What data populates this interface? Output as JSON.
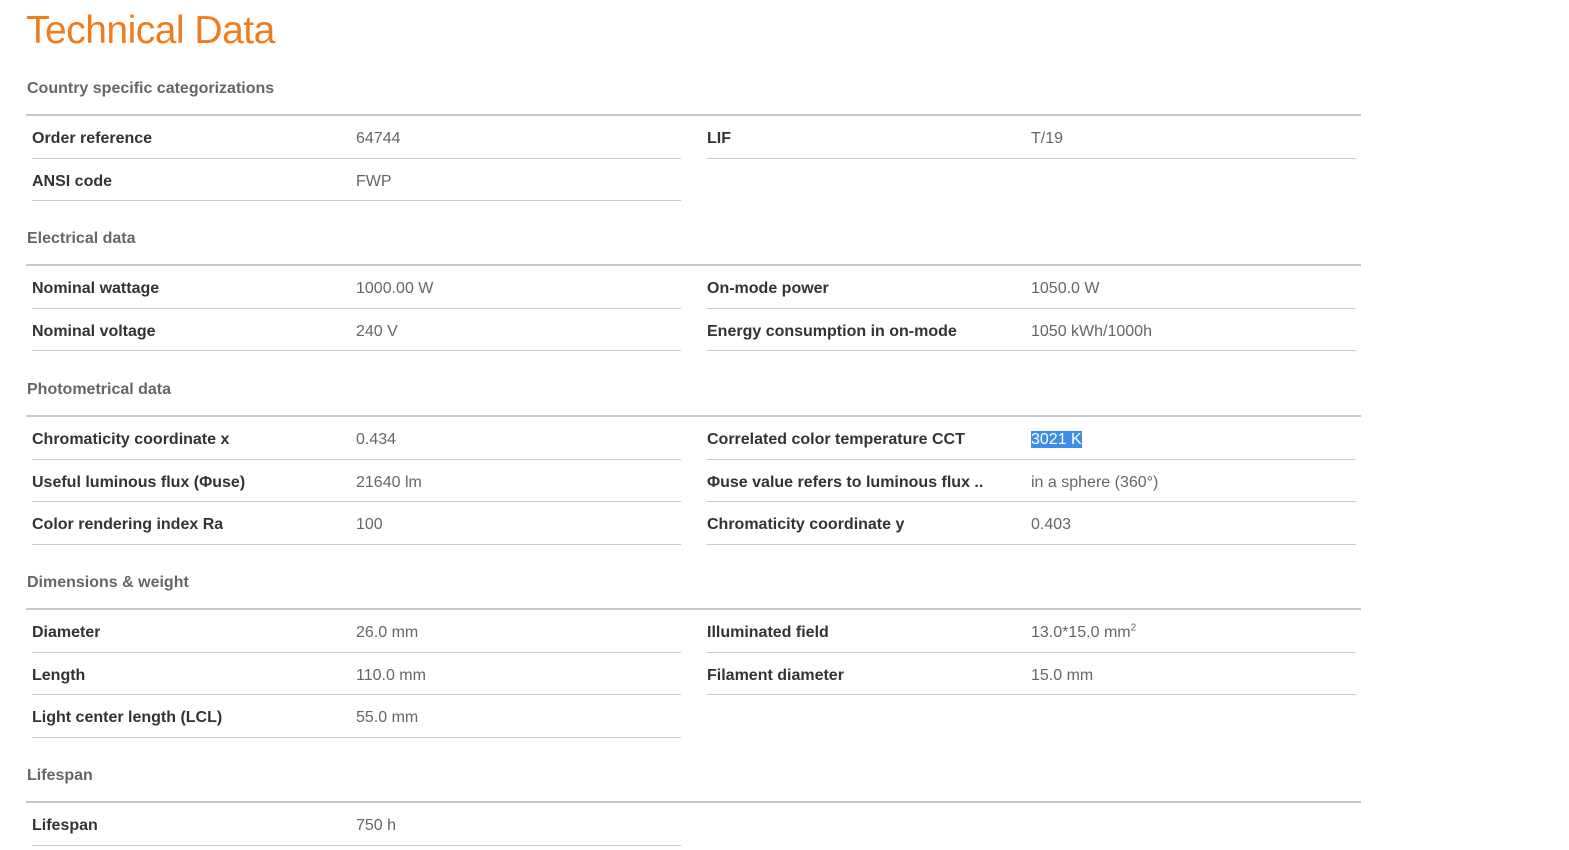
{
  "page": {
    "title": "Technical Data",
    "accent_color": "#ef7d1f"
  },
  "sections": [
    {
      "title": "Country specific categorizations",
      "left": [
        {
          "label": "Order reference",
          "value": "64744"
        },
        {
          "label": "ANSI code",
          "value": "FWP"
        }
      ],
      "right": [
        {
          "label": "LIF",
          "value": "T/19"
        }
      ]
    },
    {
      "title": "Electrical data",
      "left": [
        {
          "label": "Nominal wattage",
          "value": "1000.00 W"
        },
        {
          "label": "Nominal voltage",
          "value": "240 V"
        }
      ],
      "right": [
        {
          "label": "On-mode power",
          "value": "1050.0 W"
        },
        {
          "label": "Energy consumption in on-mode",
          "value": "1050 kWh/1000h"
        }
      ]
    },
    {
      "title": "Photometrical data",
      "left": [
        {
          "label": "Chromaticity coordinate x",
          "value": "0.434"
        },
        {
          "label": "Useful luminous flux (Φuse)",
          "value": "21640 lm"
        },
        {
          "label": "Color rendering index Ra",
          "value": "100"
        }
      ],
      "right": [
        {
          "label": "Correlated color temperature CCT",
          "value": "3021 K",
          "selected": true
        },
        {
          "label": "Φuse value refers to luminous flux ..",
          "value": "in a sphere (360°)"
        },
        {
          "label": "Chromaticity coordinate y",
          "value": "0.403"
        }
      ]
    },
    {
      "title": "Dimensions & weight",
      "left": [
        {
          "label": "Diameter",
          "value": "26.0 mm"
        },
        {
          "label": "Length",
          "value": "110.0 mm"
        },
        {
          "label": "Light center length (LCL)",
          "value": "55.0 mm"
        }
      ],
      "right": [
        {
          "label": "Illuminated field",
          "value": "13.0*15.0 mm",
          "superscript": "2"
        },
        {
          "label": "Filament diameter",
          "value": "15.0 mm"
        }
      ]
    },
    {
      "title": "Lifespan",
      "left": [
        {
          "label": "Lifespan",
          "value": "750 h"
        }
      ],
      "right": []
    }
  ]
}
